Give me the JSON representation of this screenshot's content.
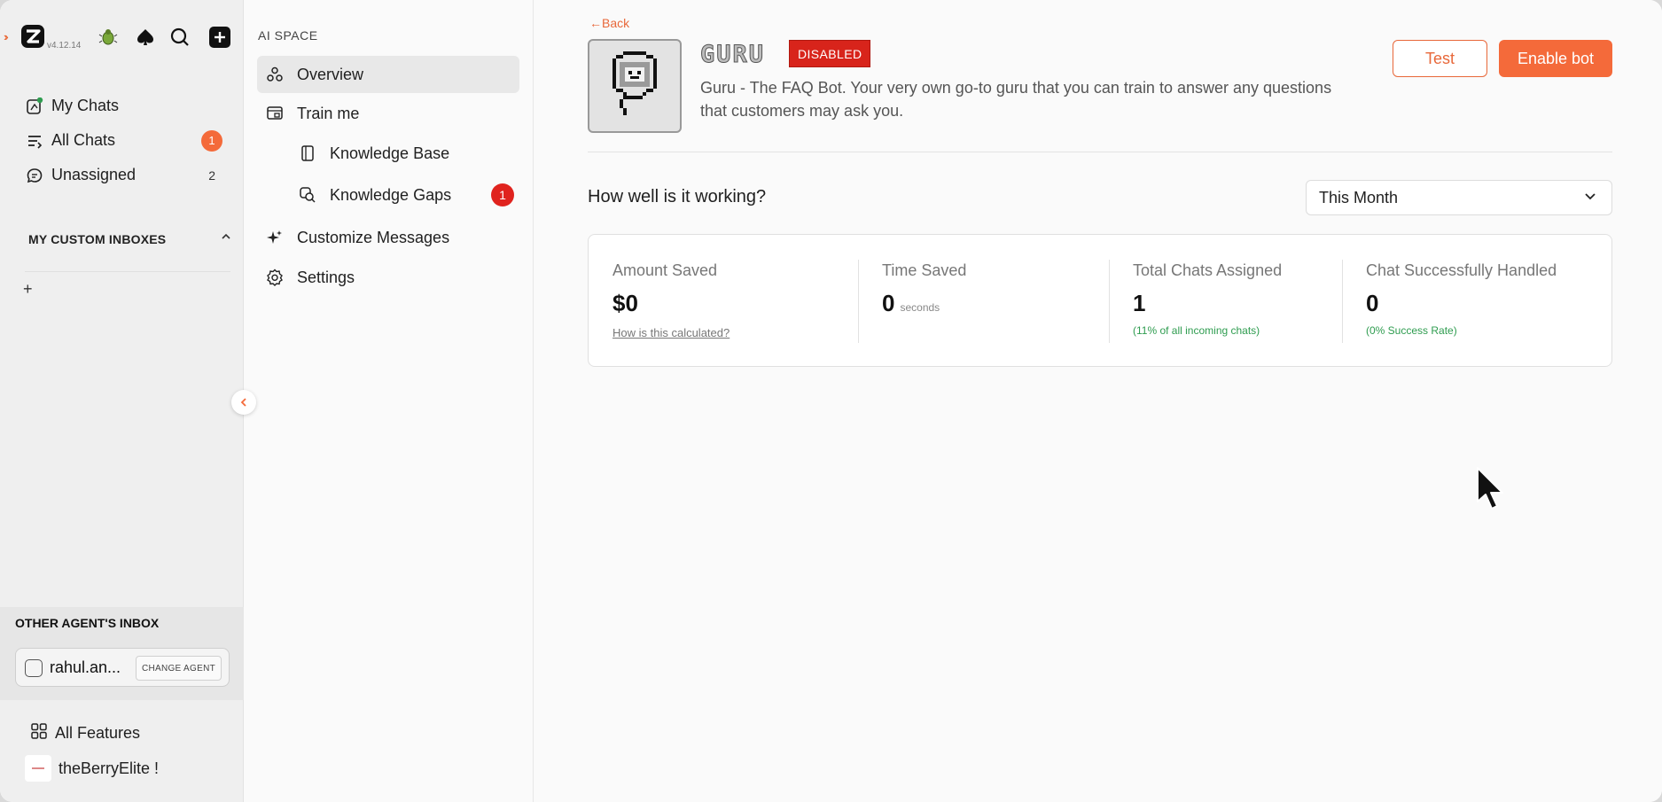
{
  "rail": {
    "version": "v4.12.14",
    "nav": [
      {
        "label": "My Chats",
        "badge": "",
        "count": ""
      },
      {
        "label": "All Chats",
        "badge": "1",
        "count": ""
      },
      {
        "label": "Unassigned",
        "badge": "",
        "count": "2"
      }
    ],
    "custom_inboxes_header": "MY CUSTOM INBOXES",
    "add_label": "+",
    "other_agent_header": "OTHER AGENT'S INBOX",
    "agent_name": "rahul.an...",
    "change_agent_label": "CHANGE AGENT",
    "all_features": "All Features",
    "org_name": "theBerryElite !"
  },
  "sub": {
    "header": "AI SPACE",
    "items": [
      {
        "label": "Overview",
        "icon": "overview-icon",
        "active": true
      },
      {
        "label": "Train me",
        "icon": "train-icon"
      },
      {
        "label": "Knowledge Base",
        "icon": "book-icon"
      },
      {
        "label": "Knowledge Gaps",
        "icon": "search-gaps-icon",
        "badge": "1"
      },
      {
        "label": "Customize Messages",
        "icon": "sparkle-icon"
      },
      {
        "label": "Settings",
        "icon": "settings-icon"
      }
    ]
  },
  "main": {
    "back": "←Back",
    "bot_title": "GURU",
    "status_badge": "DISABLED",
    "description": "Guru - The FAQ Bot. Your very own go-to guru that you can train to answer any questions that customers may ask you.",
    "test_label": "Test",
    "enable_label": "Enable bot",
    "section_title": "How well is it working?",
    "period_selected": "This Month",
    "stats": [
      {
        "label": "Amount Saved",
        "value": "$0",
        "link": "How is this calculated?"
      },
      {
        "label": "Time Saved",
        "value": "0",
        "unit": "seconds"
      },
      {
        "label": "Total Chats Assigned",
        "value": "1",
        "sub": "(11% of all incoming chats)"
      },
      {
        "label": "Chat Successfully Handled",
        "value": "0",
        "sub": "(0% Success Rate)"
      }
    ]
  },
  "colors": {
    "accent": "#f46a3a",
    "disabled_red": "#d8241b",
    "success_green": "#2e9c4f"
  }
}
